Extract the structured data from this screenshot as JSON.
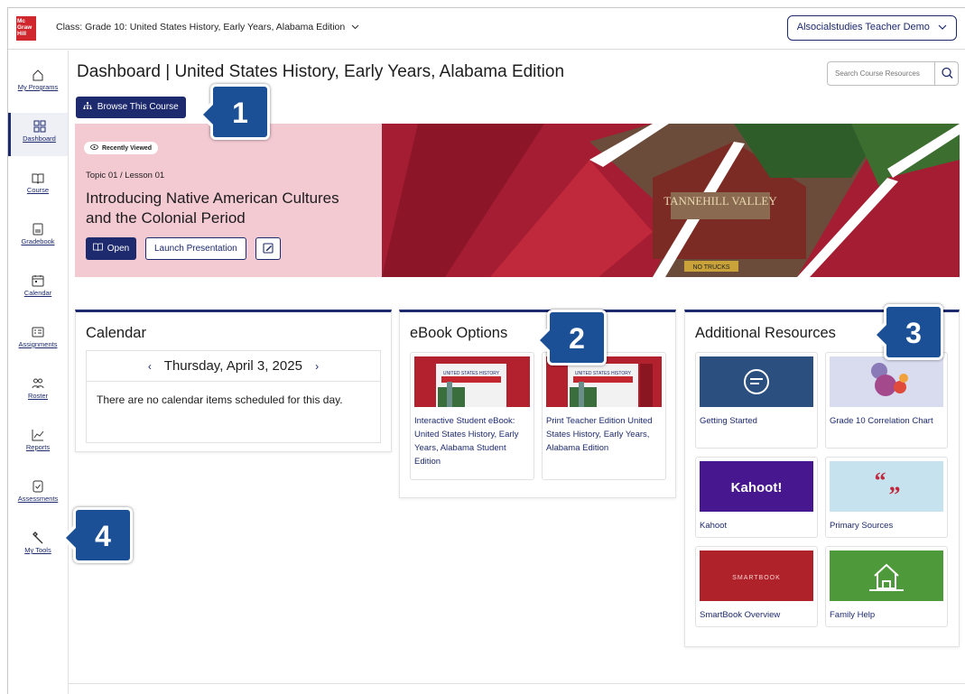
{
  "header": {
    "logo_text": "Mc Graw Hill",
    "class_label": "Class: Grade 10: United States History, Early Years, Alabama Edition",
    "user_button": "Alsocialstudies Teacher Demo"
  },
  "sidebar": {
    "items": [
      {
        "label": "My Programs",
        "icon": "home-icon"
      },
      {
        "label": "Dashboard",
        "icon": "dashboard-icon"
      },
      {
        "label": "Course",
        "icon": "book-icon"
      },
      {
        "label": "Gradebook",
        "icon": "gradebook-icon"
      },
      {
        "label": "Calendar",
        "icon": "calendar-icon"
      },
      {
        "label": "Assignments",
        "icon": "assignments-icon"
      },
      {
        "label": "Roster",
        "icon": "roster-icon"
      },
      {
        "label": "Reports",
        "icon": "reports-icon"
      },
      {
        "label": "Assessments",
        "icon": "assessments-icon"
      },
      {
        "label": "My Tools",
        "icon": "wrench-icon"
      }
    ]
  },
  "page": {
    "title": "Dashboard | United States History, Early Years, Alabama Edition",
    "search_placeholder": "Search Course Resources",
    "browse_button": "Browse This Course"
  },
  "hero": {
    "badge": "Recently Viewed",
    "topic": "Topic 01 / Lesson 01",
    "title": "Introducing Native American Cultures and the Colonial Period",
    "open_button": "Open",
    "launch_button": "Launch Presentation",
    "sign_text": "TANNEHILL VALLEY",
    "truck_sign": "NO TRUCKS"
  },
  "calendar": {
    "title": "Calendar",
    "date": "Thursday, April 3, 2025",
    "empty_message": "There are no calendar items scheduled for this day."
  },
  "ebook": {
    "title": "eBook Options",
    "cover_text": "UNITED STATES HISTORY",
    "items": [
      {
        "label": "Interactive Student eBook: United States History, Early Years, Alabama Student Edition"
      },
      {
        "label": "Print Teacher Edition United States History, Early Years, Alabama Edition"
      }
    ]
  },
  "resources": {
    "title": "Additional Resources",
    "items": [
      {
        "label": "Getting Started",
        "color": "#2b4f7e"
      },
      {
        "label": "Grade 10 Correlation Chart",
        "color": "#d9dcef"
      },
      {
        "label": "Kahoot",
        "color": "#46178f",
        "logo": "Kahoot!"
      },
      {
        "label": "Primary Sources",
        "color": "#c6e2ee"
      },
      {
        "label": "SmartBook Overview",
        "color": "#b0222a",
        "logo": "SMARTBOOK"
      },
      {
        "label": "Family Help",
        "color": "#4e9a3a"
      }
    ]
  },
  "callouts": [
    "1",
    "2",
    "3",
    "4"
  ],
  "colors": {
    "brand_navy": "#1d2a6e",
    "callout_blue": "#1b4f96",
    "hero_pink": "#f3c9d2",
    "hero_red": "#a51d33",
    "logo_red": "#d0262d"
  }
}
